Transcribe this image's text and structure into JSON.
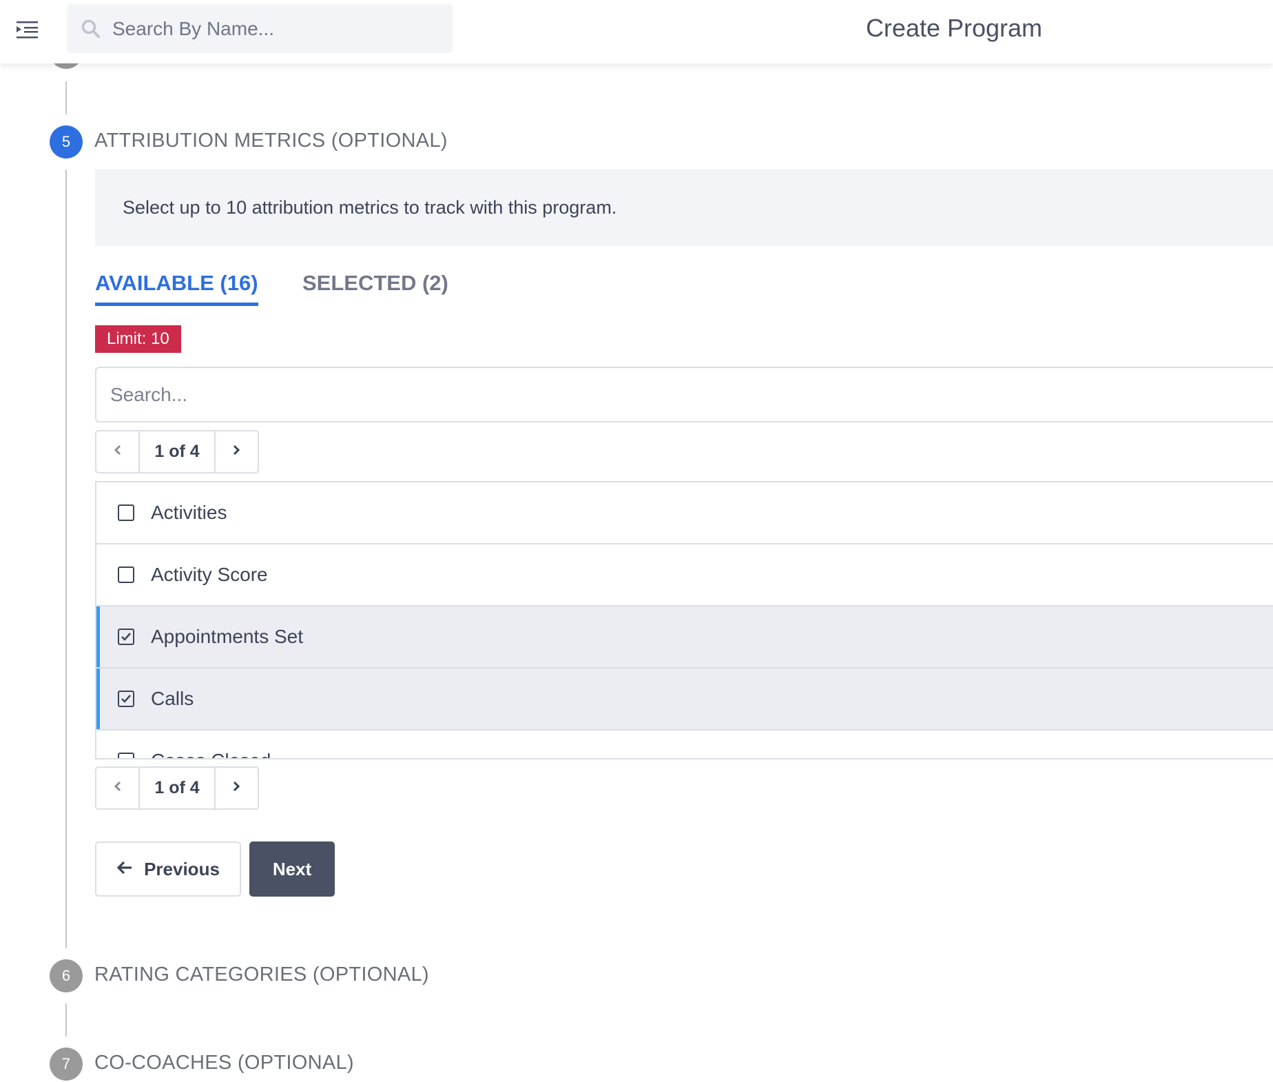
{
  "header": {
    "search_placeholder": "Search By Name...",
    "title": "Create Program"
  },
  "steps": {
    "current": {
      "number": "5",
      "title": "ATTRIBUTION METRICS (OPTIONAL)"
    },
    "next": [
      {
        "number": "6",
        "title": "RATING CATEGORIES (OPTIONAL)"
      },
      {
        "number": "7",
        "title": "CO-COACHES (OPTIONAL)"
      }
    ]
  },
  "attribution": {
    "info_text": "Select up to 10 attribution metrics to track with this program.",
    "tabs": [
      {
        "label": "AVAILABLE (16)",
        "active": true
      },
      {
        "label": "SELECTED (2)",
        "active": false
      }
    ],
    "limit_badge": "Limit: 10",
    "search_placeholder": "Search...",
    "pager_top": {
      "label": "1 of 4"
    },
    "pager_bottom": {
      "label": "1 of 4"
    },
    "items": [
      {
        "label": "Activities",
        "checked": false
      },
      {
        "label": "Activity Score",
        "checked": false
      },
      {
        "label": "Appointments Set",
        "checked": true
      },
      {
        "label": "Calls",
        "checked": true
      },
      {
        "label": "Cases Closed",
        "checked": false
      }
    ]
  },
  "actions": {
    "previous_label": "Previous",
    "next_label": "Next"
  },
  "colors": {
    "accent": "#2d6fe0",
    "limit_badge": "#cc2b4b",
    "selected_bar": "#3d9bf0",
    "primary_button": "#4b5164"
  }
}
